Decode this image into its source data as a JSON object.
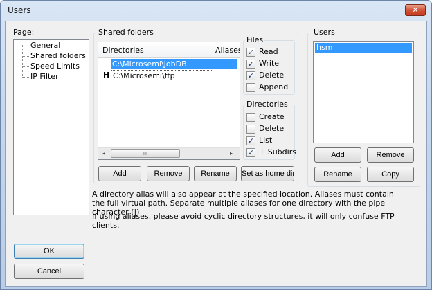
{
  "window": {
    "title": "Users",
    "close_glyph": "✕"
  },
  "page_panel": {
    "label": "Page:",
    "items": [
      "General",
      "Shared folders",
      "Speed Limits",
      "IP Filter"
    ]
  },
  "shared_folders": {
    "group_title": "Shared folders",
    "columns": [
      "Directories",
      "Aliases"
    ],
    "rows": [
      {
        "marker": "",
        "directory": "C:\\Microsemi\\JobDB",
        "alias": "",
        "selected": true
      },
      {
        "marker": "H",
        "directory": "C:\\Microsemi\\ftp",
        "alias": "",
        "selected": false
      }
    ],
    "scroll_thumb_grip": "III",
    "scroll_left": "◂",
    "scroll_right": "▸",
    "buttons": {
      "add": "Add",
      "remove": "Remove",
      "rename": "Rename",
      "set_home": "Set as home dir"
    }
  },
  "files": {
    "group_title": "Files",
    "options": [
      {
        "label": "Read",
        "checked": true
      },
      {
        "label": "Write",
        "checked": true
      },
      {
        "label": "Delete",
        "checked": true
      },
      {
        "label": "Append",
        "checked": false
      }
    ]
  },
  "directories": {
    "group_title": "Directories",
    "options": [
      {
        "label": "Create",
        "checked": false
      },
      {
        "label": "Delete",
        "checked": false
      },
      {
        "label": "List",
        "checked": true
      },
      {
        "label": "+ Subdirs",
        "checked": true
      }
    ]
  },
  "users": {
    "group_title": "Users",
    "list": [
      "hsm"
    ],
    "buttons": {
      "add": "Add",
      "remove": "Remove",
      "rename": "Rename",
      "copy": "Copy"
    }
  },
  "info": {
    "line1": "A directory alias will also appear at the specified location. Aliases must contain the full virtual path. Separate multiple aliases for one directory with the pipe character (|)",
    "line2": "If using aliases, please avoid cyclic directory structures, it will only confuse FTP clients."
  },
  "footer": {
    "ok": "OK",
    "cancel": "Cancel"
  },
  "check_glyph": "✓"
}
